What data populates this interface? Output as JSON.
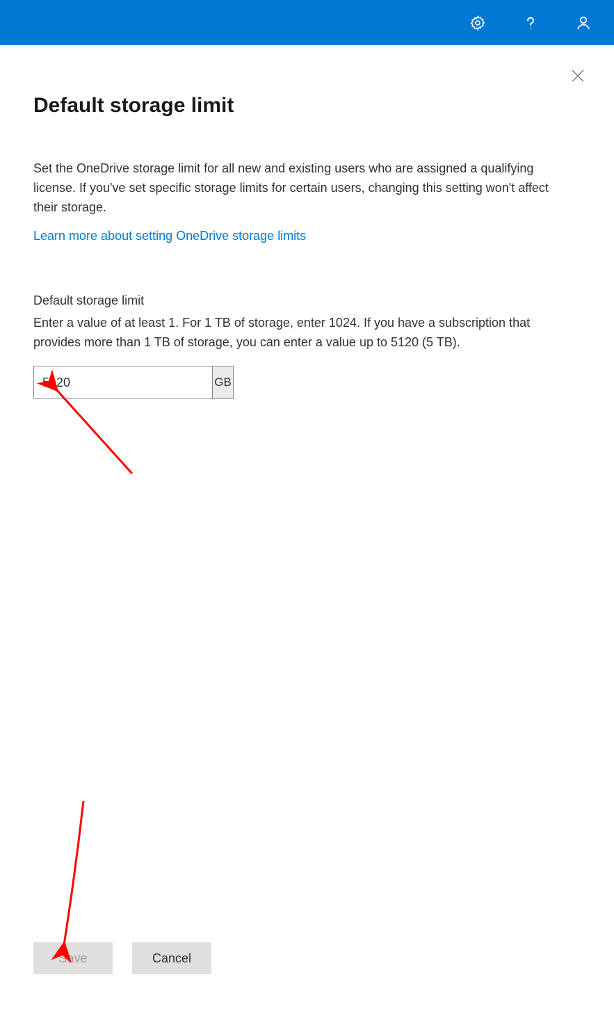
{
  "header": {
    "icons": [
      "settings",
      "help",
      "account"
    ]
  },
  "panel": {
    "title": "Default storage limit",
    "description": "Set the OneDrive storage limit for all new and existing users who are assigned a qualifying license. If you've set specific storage limits for certain users, changing this setting won't affect their storage.",
    "learnMoreLabel": "Learn more about setting OneDrive storage limits",
    "fieldLabel": "Default storage limit",
    "fieldHelp": "Enter a value of at least 1. For 1 TB of storage, enter 1024. If you have a subscription that provides more than 1 TB of storage, you can enter a value up to 5120 (5 TB).",
    "fieldValue": "5120",
    "fieldUnit": "GB"
  },
  "footer": {
    "saveLabel": "Save",
    "cancelLabel": "Cancel"
  }
}
